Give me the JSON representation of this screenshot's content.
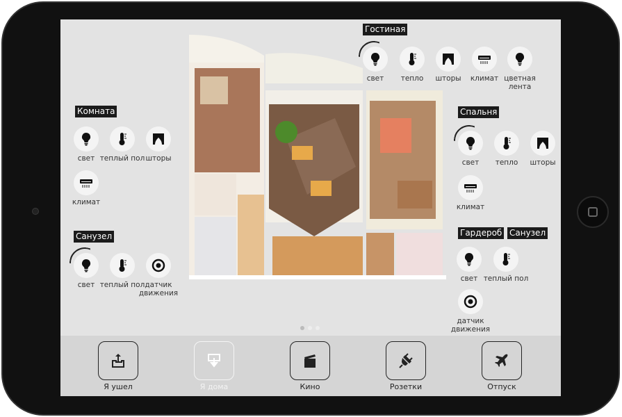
{
  "rooms": [
    {
      "name": "Гостиная",
      "label_pos": "top",
      "controls": [
        {
          "label": "свет",
          "icon": "bulb-icon",
          "active": true
        },
        {
          "label": "тепло",
          "icon": "thermometer-icon"
        },
        {
          "label": "шторы",
          "icon": "curtains-icon"
        },
        {
          "label": "климат",
          "icon": "air-conditioner-icon"
        },
        {
          "label": "цветная лента",
          "icon": "bulb-icon"
        }
      ]
    },
    {
      "name": "Комната",
      "controls": [
        {
          "label": "свет",
          "icon": "bulb-icon"
        },
        {
          "label": "теплый пол",
          "icon": "thermometer-icon"
        },
        {
          "label": "шторы",
          "icon": "curtains-icon"
        },
        {
          "label": "климат",
          "icon": "air-conditioner-icon"
        }
      ]
    },
    {
      "name": "Санузел",
      "controls": [
        {
          "label": "свет",
          "icon": "bulb-icon",
          "active": true
        },
        {
          "label": "теплый пол",
          "icon": "thermometer-icon"
        },
        {
          "label": "датчик движения",
          "icon": "motion-sensor-icon"
        }
      ]
    },
    {
      "name": "Спальня",
      "controls": [
        {
          "label": "свет",
          "icon": "bulb-icon",
          "active": true
        },
        {
          "label": "тепло",
          "icon": "thermometer-icon"
        },
        {
          "label": "шторы",
          "icon": "curtains-icon"
        },
        {
          "label": "климат",
          "icon": "air-conditioner-icon"
        }
      ]
    },
    {
      "name": "Гардероб",
      "name2": "Санузел",
      "controls": [
        {
          "label": "свет",
          "icon": "bulb-icon"
        },
        {
          "label": "теплый пол",
          "icon": "thermometer-icon"
        },
        {
          "label": "датчик движения",
          "icon": "motion-sensor-icon"
        }
      ]
    }
  ],
  "pagination": {
    "pages": 3,
    "current": 1
  },
  "scenes": [
    {
      "label": "Я ушел",
      "icon": "leave-home-icon",
      "active": true
    },
    {
      "label": "Я дома",
      "icon": "at-home-icon",
      "active": false
    },
    {
      "label": "Кино",
      "icon": "clapperboard-icon",
      "active": true
    },
    {
      "label": "Розетки",
      "icon": "plug-icon",
      "active": true
    },
    {
      "label": "Отпуск",
      "icon": "airplane-icon",
      "active": true
    }
  ]
}
